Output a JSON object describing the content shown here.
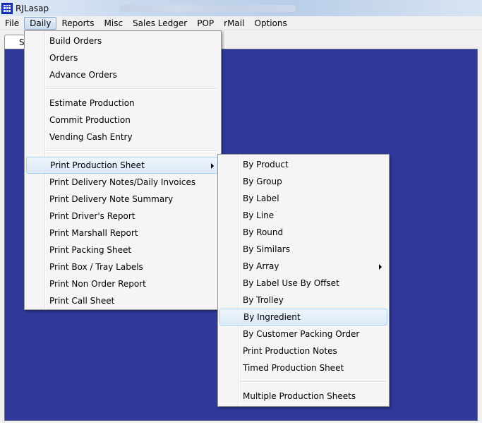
{
  "window": {
    "title": "RJLasap"
  },
  "menubar": [
    "File",
    "Daily",
    "Reports",
    "Misc",
    "Sales Ledger",
    "POP",
    "rMail",
    "Options"
  ],
  "tab": {
    "label": "S"
  },
  "daily_menu": {
    "group1": [
      "Build Orders",
      "Orders",
      "Advance Orders"
    ],
    "group2": [
      "Estimate Production",
      "Commit Production",
      "Vending Cash Entry"
    ],
    "group3": [
      "Print Production Sheet",
      "Print Delivery Notes/Daily Invoices",
      "Print Delivery Note Summary",
      "Print Driver's Report",
      "Print Marshall Report",
      "Print Packing Sheet",
      "Print Box / Tray Labels",
      "Print Non Order Report",
      "Print Call Sheet"
    ]
  },
  "production_submenu": {
    "items": [
      "By Product",
      "By Group",
      "By Label",
      "By Line",
      "By Round",
      "By Similars",
      "By Array",
      "By Label Use By Offset",
      "By Trolley",
      "By Ingredient",
      "By Customer Packing Order",
      "Print Production Notes",
      "Timed Production Sheet"
    ],
    "footer": [
      "Multiple Production Sheets"
    ]
  },
  "colors": {
    "workspace": "#30389a",
    "highlight": "#dbe9f8"
  }
}
